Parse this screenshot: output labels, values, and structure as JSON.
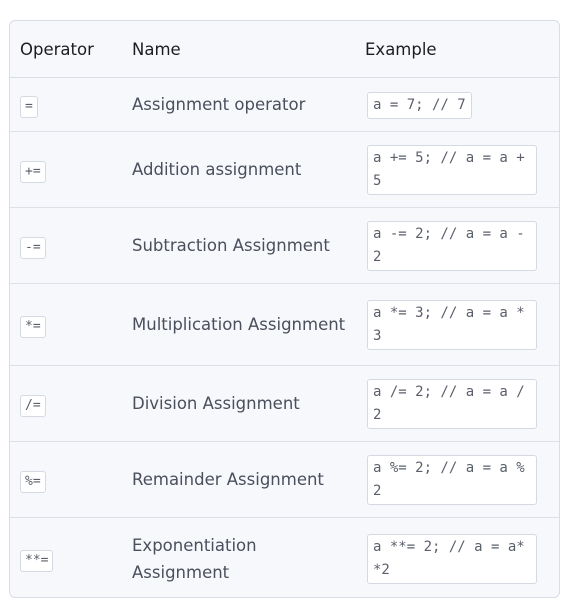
{
  "table": {
    "headers": {
      "operator": "Operator",
      "name": "Name",
      "example": "Example"
    },
    "rows": [
      {
        "operator": "=",
        "name": "Assignment operator",
        "example": "a = 7; // 7"
      },
      {
        "operator": "+=",
        "name": "Addition assignment",
        "example": "a += 5; // a = a + 5"
      },
      {
        "operator": "-=",
        "name": "Subtraction Assignment",
        "example": "a -= 2; // a = a - 2"
      },
      {
        "operator": "*=",
        "name": "Multiplication Assignment",
        "example": "a *= 3; // a = a * 3"
      },
      {
        "operator": "/=",
        "name": "Division Assignment",
        "example": "a /= 2; // a = a / 2"
      },
      {
        "operator": "%=",
        "name": "Remainder Assignment",
        "example": "a %= 2; // a = a % 2"
      },
      {
        "operator": "**=",
        "name": "Exponentiation Assignment",
        "example": "a **= 2; // a = a**2"
      }
    ]
  }
}
